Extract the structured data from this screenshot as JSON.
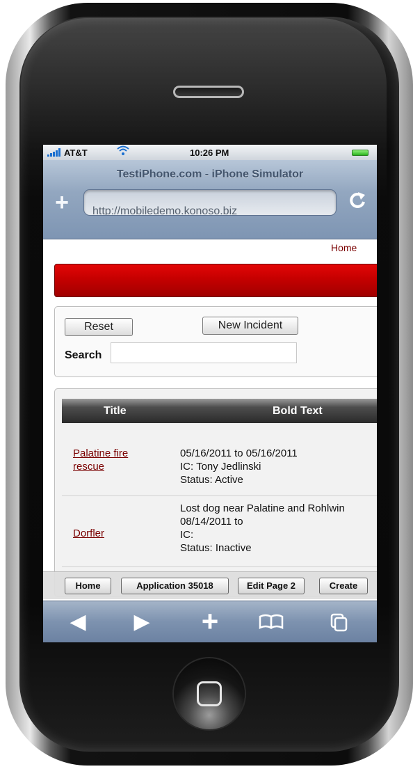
{
  "status_bar": {
    "carrier": "AT&T",
    "time": "10:26 PM"
  },
  "browser": {
    "page_title": "TestiPhone.com - iPhone Simulator",
    "url": "http://mobiledemo.konoso.biz"
  },
  "header": {
    "home_link": "Home"
  },
  "search_panel": {
    "reset_label": "Reset",
    "new_incident_label": "New Incident",
    "search_label": "Search",
    "search_value": ""
  },
  "table": {
    "columns": [
      "Title",
      "Bold Text"
    ],
    "rows": [
      {
        "title": "Palatine fire rescue",
        "detail_lines": [
          "05/16/2011 to 05/16/2011",
          "IC: Tony Jedlinski",
          "Status: Active"
        ]
      },
      {
        "title": "Dorfler",
        "detail_lines": [
          "Lost dog near Palatine and Rohlwin",
          "08/14/2011 to",
          "IC:",
          "Status: Inactive"
        ]
      }
    ]
  },
  "bottom_toolbar": {
    "home": "Home",
    "application": "Application 35018",
    "edit_page": "Edit Page 2",
    "create": "Create"
  },
  "theme": {
    "accent_red": "#c50000",
    "link_color": "#7a0000",
    "wifi_blue": "#1a6fd0"
  },
  "icons": [
    "back-arrow-icon",
    "forward-arrow-icon",
    "add-icon",
    "bookmarks-icon",
    "pages-icon",
    "reload-icon",
    "wifi-icon",
    "signal-icon",
    "battery-icon"
  ]
}
